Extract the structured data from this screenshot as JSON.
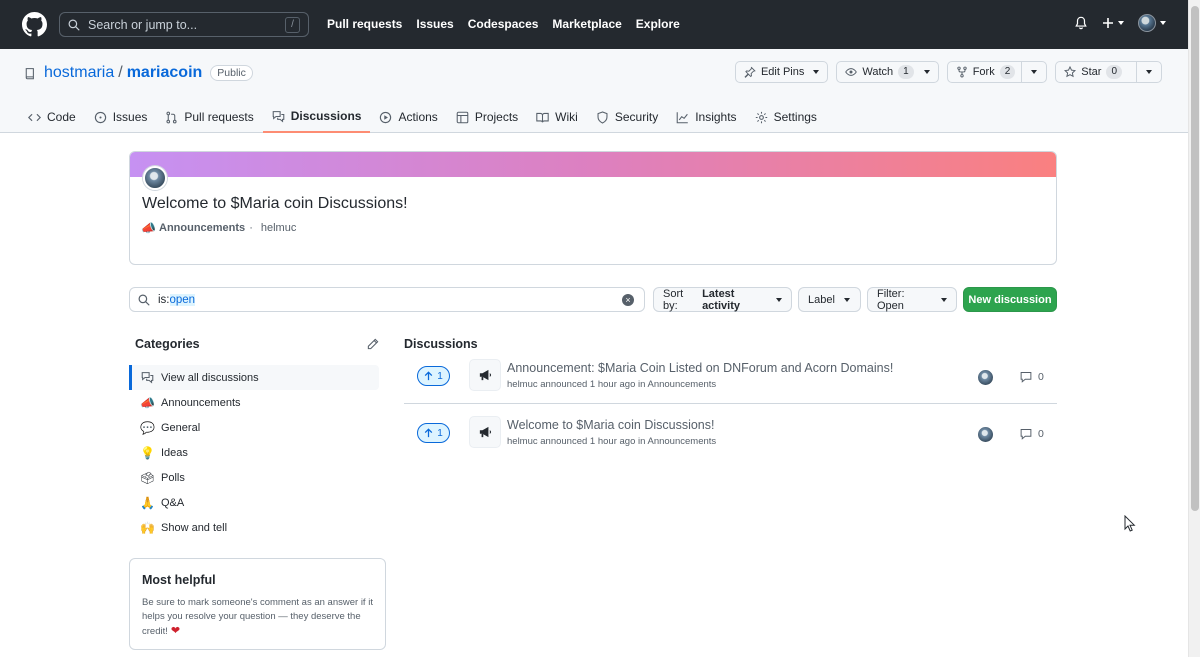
{
  "header": {
    "search_placeholder": "Search or jump to...",
    "slash_key": "/",
    "nav": [
      "Pull requests",
      "Issues",
      "Codespaces",
      "Marketplace",
      "Explore"
    ],
    "plus_label": "+"
  },
  "repo": {
    "owner": "hostmaria",
    "separator": "/",
    "name": "mariacoin",
    "visibility": "Public",
    "edit_pins": "Edit Pins",
    "watch": "Watch",
    "watch_count": "1",
    "fork": "Fork",
    "fork_count": "2",
    "star": "Star",
    "star_count": "0"
  },
  "tabs": [
    "Code",
    "Issues",
    "Pull requests",
    "Discussions",
    "Actions",
    "Projects",
    "Wiki",
    "Security",
    "Insights",
    "Settings"
  ],
  "welcome": {
    "title": "Welcome to $Maria coin Discussions!",
    "category": "Announcements",
    "dot": "·",
    "author": "helmuc"
  },
  "search": {
    "prefix": "is:",
    "value": "open"
  },
  "filters": {
    "sort_prefix": "Sort by:",
    "sort_value": "Latest activity",
    "label": "Label",
    "filter": "Filter: Open",
    "new_discussion": "New discussion"
  },
  "sidebar": {
    "heading": "Categories",
    "items": [
      {
        "label": "View all discussions",
        "icon": "speech-bubbles-icon"
      },
      {
        "label": "Announcements",
        "icon": "megaphone-icon"
      },
      {
        "label": "General",
        "icon": "speech-balloon-icon"
      },
      {
        "label": "Ideas",
        "icon": "lightbulb-icon"
      },
      {
        "label": "Polls",
        "icon": "ballot-box-icon"
      },
      {
        "label": "Q&A",
        "icon": "praying-hands-icon"
      },
      {
        "label": "Show and tell",
        "icon": "raised-hands-icon"
      }
    ],
    "helpful_title": "Most helpful",
    "helpful_text": "Be sure to mark someone's comment as an answer if it helps you resolve your question — they deserve the credit!"
  },
  "discussions": {
    "heading": "Discussions",
    "items": [
      {
        "votes": "1",
        "title": "Announcement: $Maria Coin Listed on DNForum and Acorn Domains!",
        "meta": "helmuc announced 1 hour ago in Announcements",
        "comments": "0"
      },
      {
        "votes": "1",
        "title": "Welcome to $Maria coin Discussions!",
        "meta": "helmuc announced 1 hour ago in Announcements",
        "comments": "0"
      }
    ]
  }
}
